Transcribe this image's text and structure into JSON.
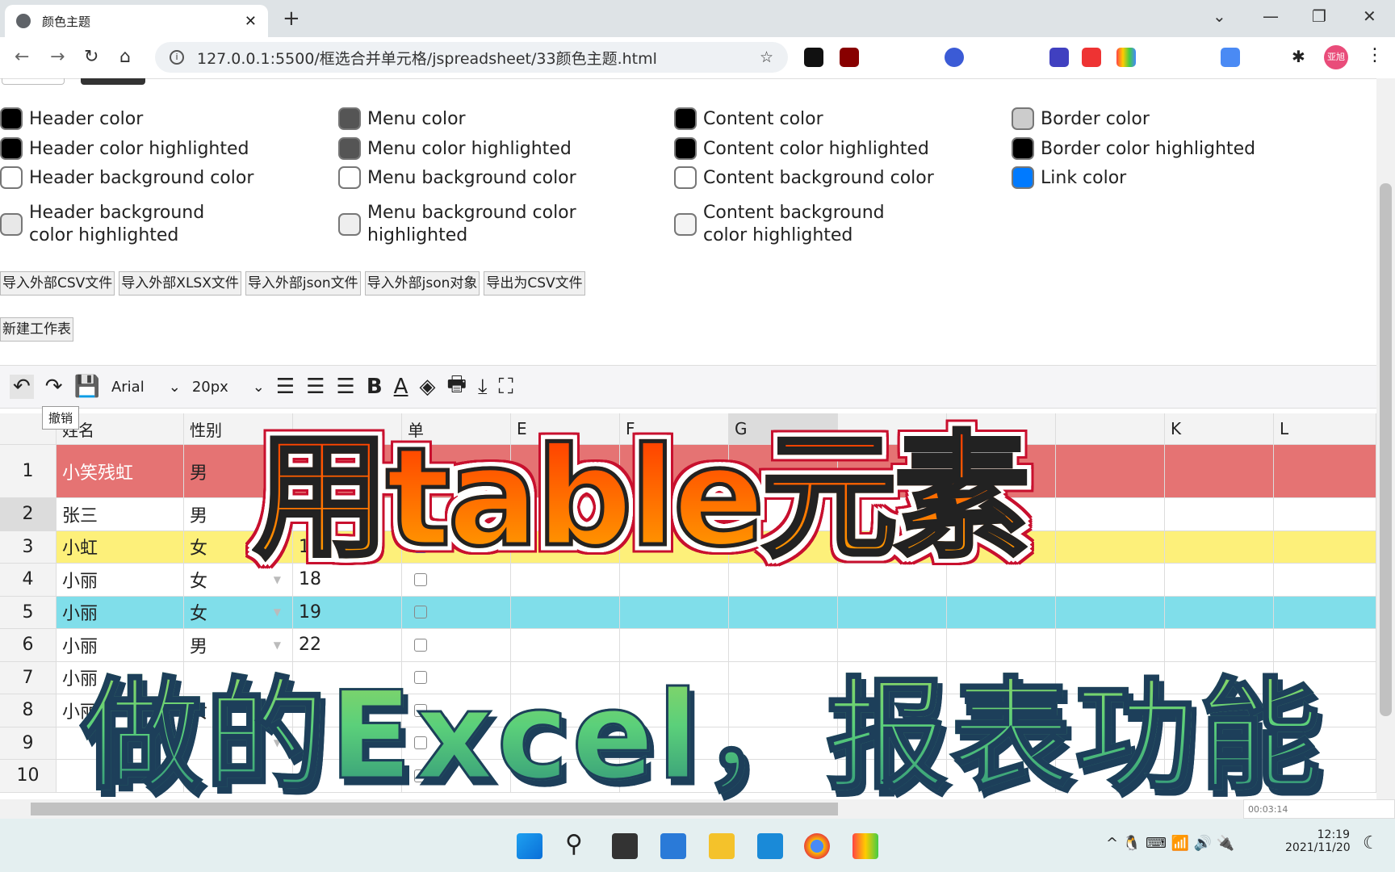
{
  "browser": {
    "tab_title": "颜色主题",
    "url": "127.0.0.1:5500/框选合并单元格/jspreadsheet/33颜色主题.html",
    "profile": "亚旭"
  },
  "color_options": [
    [
      {
        "label": "Header color",
        "color": "#000000"
      },
      {
        "label": "Header color highlighted",
        "color": "#000000"
      },
      {
        "label": "Header background color",
        "color": "#ffffff"
      },
      {
        "label": "Header background color highlighted",
        "color": "#e8e8e8"
      }
    ],
    [
      {
        "label": "Menu color",
        "color": "#555555"
      },
      {
        "label": "Menu color highlighted",
        "color": "#555555"
      },
      {
        "label": "Menu background color",
        "color": "#ffffff"
      },
      {
        "label": "Menu background color highlighted",
        "color": "#eeeeee"
      }
    ],
    [
      {
        "label": "Content color",
        "color": "#000000"
      },
      {
        "label": "Content color highlighted",
        "color": "#000000"
      },
      {
        "label": "Content background color",
        "color": "#ffffff"
      },
      {
        "label": "Content background color highlighted",
        "color": "#f4f4f4"
      }
    ],
    [
      {
        "label": "Border color",
        "color": "#cccccc"
      },
      {
        "label": "Border color highlighted",
        "color": "#000000"
      },
      {
        "label": "Link color",
        "color": "#007aff"
      }
    ]
  ],
  "buttons": [
    "导入外部CSV文件",
    "导入外部XLSX文件",
    "导入外部json文件",
    "导入外部json对象",
    "导出为CSV文件"
  ],
  "new_sheet": "新建工作表",
  "toolbar": {
    "font": "Arial",
    "size": "20px",
    "tooltip": "撤销"
  },
  "columns": [
    "姓名",
    "性别",
    "",
    "单",
    "E",
    "F",
    "G",
    "",
    "",
    "",
    "K",
    "L"
  ],
  "rows": [
    {
      "n": "1",
      "cells": [
        "小笑残虹",
        "男",
        "",
        false
      ],
      "bg": "#e57373",
      "fg": "#ffffff"
    },
    {
      "n": "2",
      "cells": [
        "张三",
        "男",
        "",
        false
      ],
      "bg": "#ffffff"
    },
    {
      "n": "3",
      "cells": [
        "小虹",
        "女",
        "16",
        true
      ],
      "bg": "#fdf07a"
    },
    {
      "n": "4",
      "cells": [
        "小丽",
        "女",
        "18",
        false
      ],
      "bg": "#ffffff"
    },
    {
      "n": "5",
      "cells": [
        "小丽",
        "女",
        "19",
        false
      ],
      "bg": "#80deea"
    },
    {
      "n": "6",
      "cells": [
        "小丽",
        "男",
        "22",
        false
      ],
      "bg": "#ffffff"
    },
    {
      "n": "7",
      "cells": [
        "小丽",
        "",
        "",
        false
      ],
      "bg": "#ffffff"
    },
    {
      "n": "8",
      "cells": [
        "小丽",
        "女",
        "",
        false
      ],
      "bg": "#ffffff"
    },
    {
      "n": "9",
      "cells": [
        "",
        "",
        "",
        false
      ],
      "bg": "#ffffff"
    },
    {
      "n": "10",
      "cells": [
        "",
        "",
        "",
        false
      ],
      "bg": "#ffffff"
    }
  ],
  "overlay": {
    "line1": "用table元素",
    "line2": "做的Excel，报表功能"
  },
  "recorder_time": "00:03:14",
  "clock": {
    "time": "12:19",
    "date": "2021/11/20"
  }
}
